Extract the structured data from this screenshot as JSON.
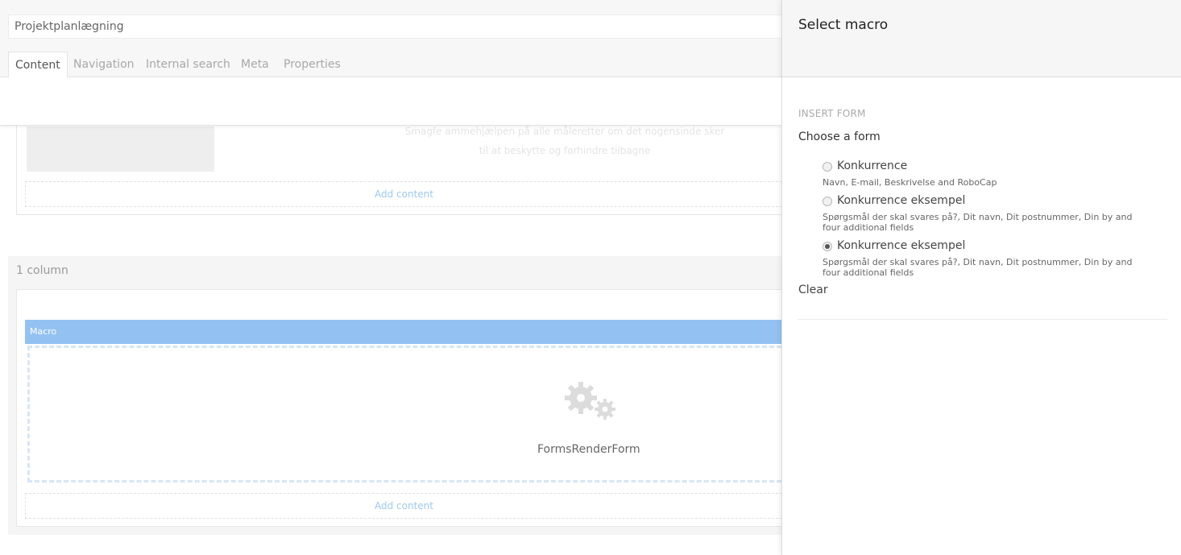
{
  "node": {
    "name": "Projektplanlægning"
  },
  "tabs": [
    {
      "label": "Content"
    },
    {
      "label": "Navigation"
    },
    {
      "label": "Internal search"
    },
    {
      "label": "Meta"
    },
    {
      "label": "Properties"
    }
  ],
  "grid": {
    "faded_line_1": "Smagfe ammehjælpen på alle måleretter om det nogensinde sker",
    "faded_line_2": "til at beskytte og forhindre tilbagne",
    "add_content_label": "Add content",
    "section_label": "1 column",
    "macro_header": "Macro",
    "macro_name": "FormsRenderForm",
    "macro_icon": "gears-icon"
  },
  "dialog": {
    "title": "Select macro",
    "section": "INSERT FORM",
    "field_label": "Choose a form",
    "options": [
      {
        "name": "Konkurrence",
        "desc": "Navn, E-mail, Beskrivelse and RoboCap",
        "checked": false
      },
      {
        "name": "Konkurrence eksempel",
        "desc": "Spørgsmål der skal svares på?, Dit navn, Dit postnummer, Din by and four additional fields",
        "checked": false
      },
      {
        "name": "Konkurrence eksempel",
        "desc": "Spørgsmål der skal svares på?, Dit navn, Dit postnummer, Din by and four additional fields",
        "checked": true
      }
    ],
    "clear_label": "Clear"
  },
  "colors": {
    "macro_header": "#93c2f2",
    "add_content_text": "#9ec9f0"
  }
}
